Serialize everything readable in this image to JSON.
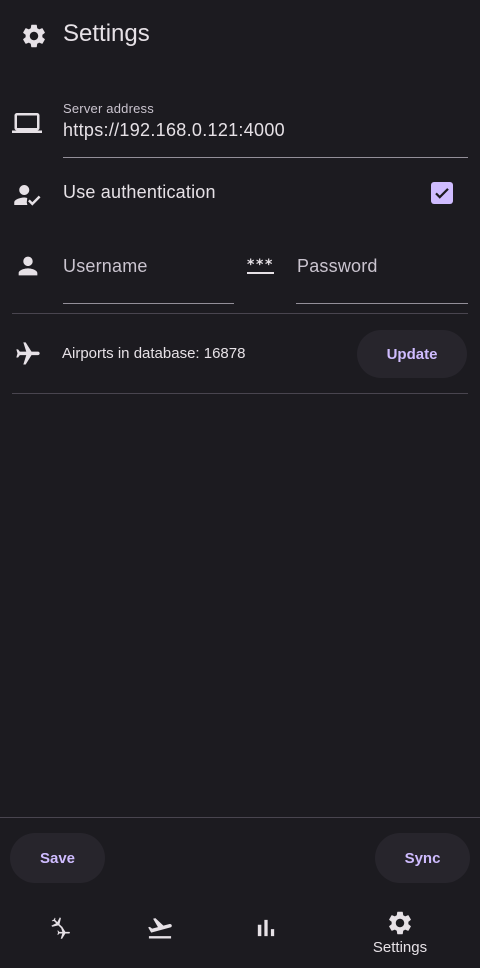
{
  "colors": {
    "background": "#1c1b20",
    "accent": "#cfbcff",
    "button_bg": "#27252c",
    "divider": "#49454f",
    "text": "#e6e1e6"
  },
  "topbar": {
    "icon": "gear-icon",
    "title": "Settings"
  },
  "server": {
    "icon": "laptop-icon",
    "label": "Server address",
    "value": "https://192.168.0.121:4000"
  },
  "auth": {
    "icon": "person-check-icon",
    "label": "Use authentication",
    "checked": true
  },
  "credentials": {
    "username_icon": "person-icon",
    "username_placeholder": "Username",
    "password_icon": "password-icon",
    "password_placeholder": "Password"
  },
  "airports": {
    "icon": "airplane-icon",
    "label": "Airports in database: 16878",
    "update_label": "Update"
  },
  "actions": {
    "save_label": "Save",
    "sync_label": "Sync"
  },
  "nav": {
    "items": [
      {
        "icon": "flights-icon",
        "label": ""
      },
      {
        "icon": "takeoff-icon",
        "label": ""
      },
      {
        "icon": "stats-icon",
        "label": ""
      },
      {
        "icon": "gear-icon",
        "label": "Settings",
        "active": true
      }
    ]
  }
}
